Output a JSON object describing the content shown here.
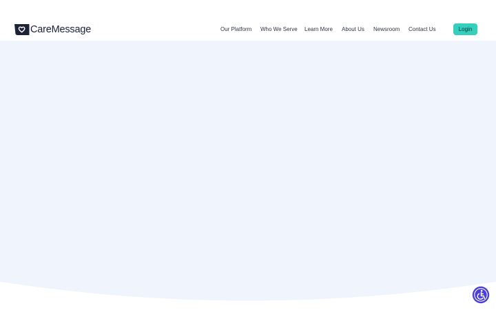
{
  "brand": {
    "name": "CareMessage",
    "icon": "heart-chat-bubble-icon"
  },
  "nav": {
    "items": [
      {
        "label": "Our Platform"
      },
      {
        "label": "Who We Serve"
      },
      {
        "label": "Learn More"
      },
      {
        "label": "About Us"
      },
      {
        "label": "Newsroom"
      },
      {
        "label": "Contact Us"
      }
    ],
    "login_label": "Login"
  },
  "accessibility": {
    "icon": "accessibility-icon"
  },
  "colors": {
    "brand_text": "#1b1f3a",
    "logo_mark": "#1e2237",
    "login_button": "#35d0bd",
    "hero_background": "#f0f4fd",
    "accessibility_button": "#4b3fd6"
  }
}
